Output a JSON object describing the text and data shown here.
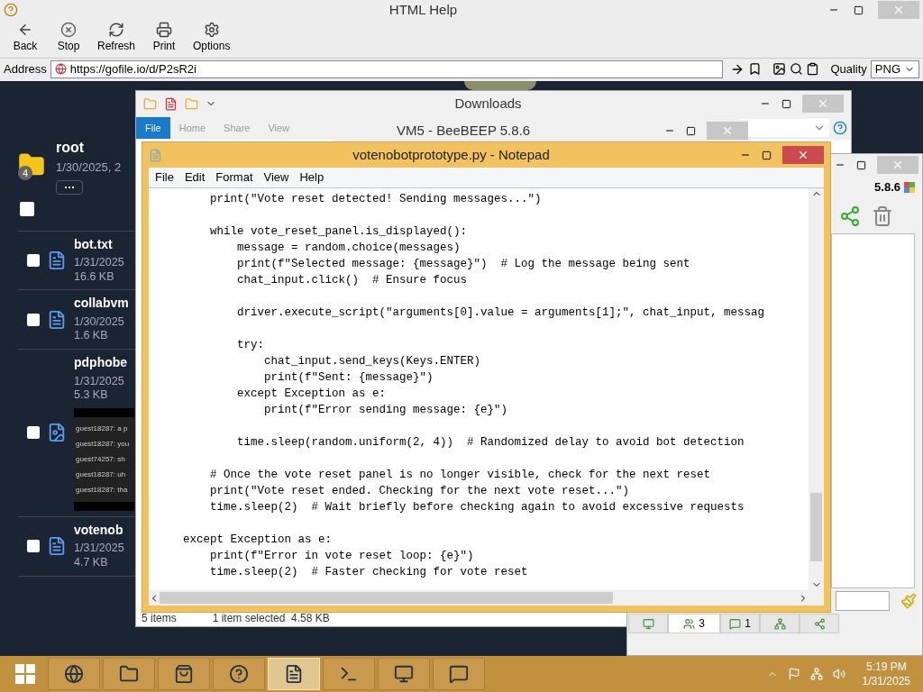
{
  "help_window": {
    "title": "HTML Help",
    "toolbar": [
      {
        "label": "Back",
        "kind": "back"
      },
      {
        "label": "Stop",
        "kind": "stop"
      },
      {
        "label": "Refresh",
        "kind": "refresh"
      },
      {
        "label": "Print",
        "kind": "print"
      },
      {
        "label": "Options",
        "kind": "options"
      }
    ],
    "address": {
      "label": "Address",
      "url": "https://gofile.io/d/P2sR2i"
    },
    "quality": {
      "label": "Quality",
      "value": "PNG"
    }
  },
  "gofile": {
    "folder": {
      "name": "root",
      "date": "1/30/2025, 2",
      "count": "4"
    },
    "select_all": {
      "checked": false
    },
    "files": [
      {
        "name": "bot.txt",
        "date": "1/31/2025",
        "size": "16.6 KB",
        "kind": "text",
        "checked": false
      },
      {
        "name": "collabvm",
        "date": "1/30/2025",
        "size": "1.6 KB",
        "kind": "text",
        "checked": false
      },
      {
        "name": "pdphobe",
        "date": "1/31/2025",
        "size": "5.3 KB",
        "kind": "image",
        "checked": false,
        "preview_lines": [
          "guest18287: a p",
          "guest18287: you",
          "guest74257: sh",
          "guest18287: uh",
          "guest18287: tha"
        ]
      },
      {
        "name": "votenob",
        "date": "1/31/2025",
        "size": "4.7 KB",
        "kind": "text",
        "checked": false
      }
    ]
  },
  "downloads": {
    "title": "Downloads",
    "ribbon_tabs": [
      {
        "label": "File",
        "selected": true
      },
      {
        "label": "Home",
        "selected": false
      },
      {
        "label": "Share",
        "selected": false
      },
      {
        "label": "View",
        "selected": false
      }
    ],
    "status": [
      "5 items",
      "1 item selected  4.58 KB"
    ]
  },
  "beebeep_chat": {
    "title": "VM5 - BeeBEEP 5.8.6"
  },
  "beebeep_main": {
    "version": "5.8.6",
    "tabs": [
      {
        "kind": "network",
        "selected": false
      },
      {
        "kind": "users",
        "count": "3",
        "selected": true
      },
      {
        "kind": "chats",
        "count": "1",
        "selected": false
      },
      {
        "kind": "groups",
        "selected": false
      },
      {
        "kind": "shares",
        "selected": false
      }
    ]
  },
  "notepad": {
    "title": "votenobotprototype.py - Notepad",
    "menu": [
      "File",
      "Edit",
      "Format",
      "View",
      "Help"
    ],
    "blocks": [
      [
        "        print(\"Vote reset detected! Sending messages...\")"
      ],
      [
        "        while vote_reset_panel.is_displayed():",
        "            message = random.choice(messages)",
        "            print(f\"Selected message: {message}\")  # Log the message being sent",
        "            chat_input.click()  # Ensure focus"
      ],
      [
        "            driver.execute_script(\"arguments[0].value = arguments[1];\", chat_input, messag"
      ],
      [
        "            try:",
        "                chat_input.send_keys(Keys.ENTER)",
        "                print(f\"Sent: {message}\")",
        "            except Exception as e:",
        "                print(f\"Error sending message: {e}\")"
      ],
      [
        "            time.sleep(random.uniform(2, 4))  # Randomized delay to avoid bot detection"
      ],
      [
        "        # Once the vote reset panel is no longer visible, check for the next reset",
        "        print(\"Vote reset ended. Checking for the next vote reset...\")",
        "        time.sleep(2)  # Wait briefly before checking again to avoid excessive requests"
      ],
      [
        "    except Exception as e:",
        "        print(f\"Error in vote reset loop: {e}\")",
        "        time.sleep(2)  # Faster checking for vote reset"
      ]
    ]
  },
  "taskbar": {
    "apps": [
      {
        "kind": "browser",
        "active": false
      },
      {
        "kind": "explorer",
        "active": false
      },
      {
        "kind": "store",
        "active": false
      },
      {
        "kind": "help",
        "active": false
      },
      {
        "kind": "notepad",
        "active": true
      },
      {
        "kind": "terminal",
        "active": false
      },
      {
        "kind": "fox",
        "active": false
      },
      {
        "kind": "bee",
        "active": false
      }
    ],
    "clock": {
      "time": "5:19 PM",
      "date": "1/31/2025"
    }
  }
}
